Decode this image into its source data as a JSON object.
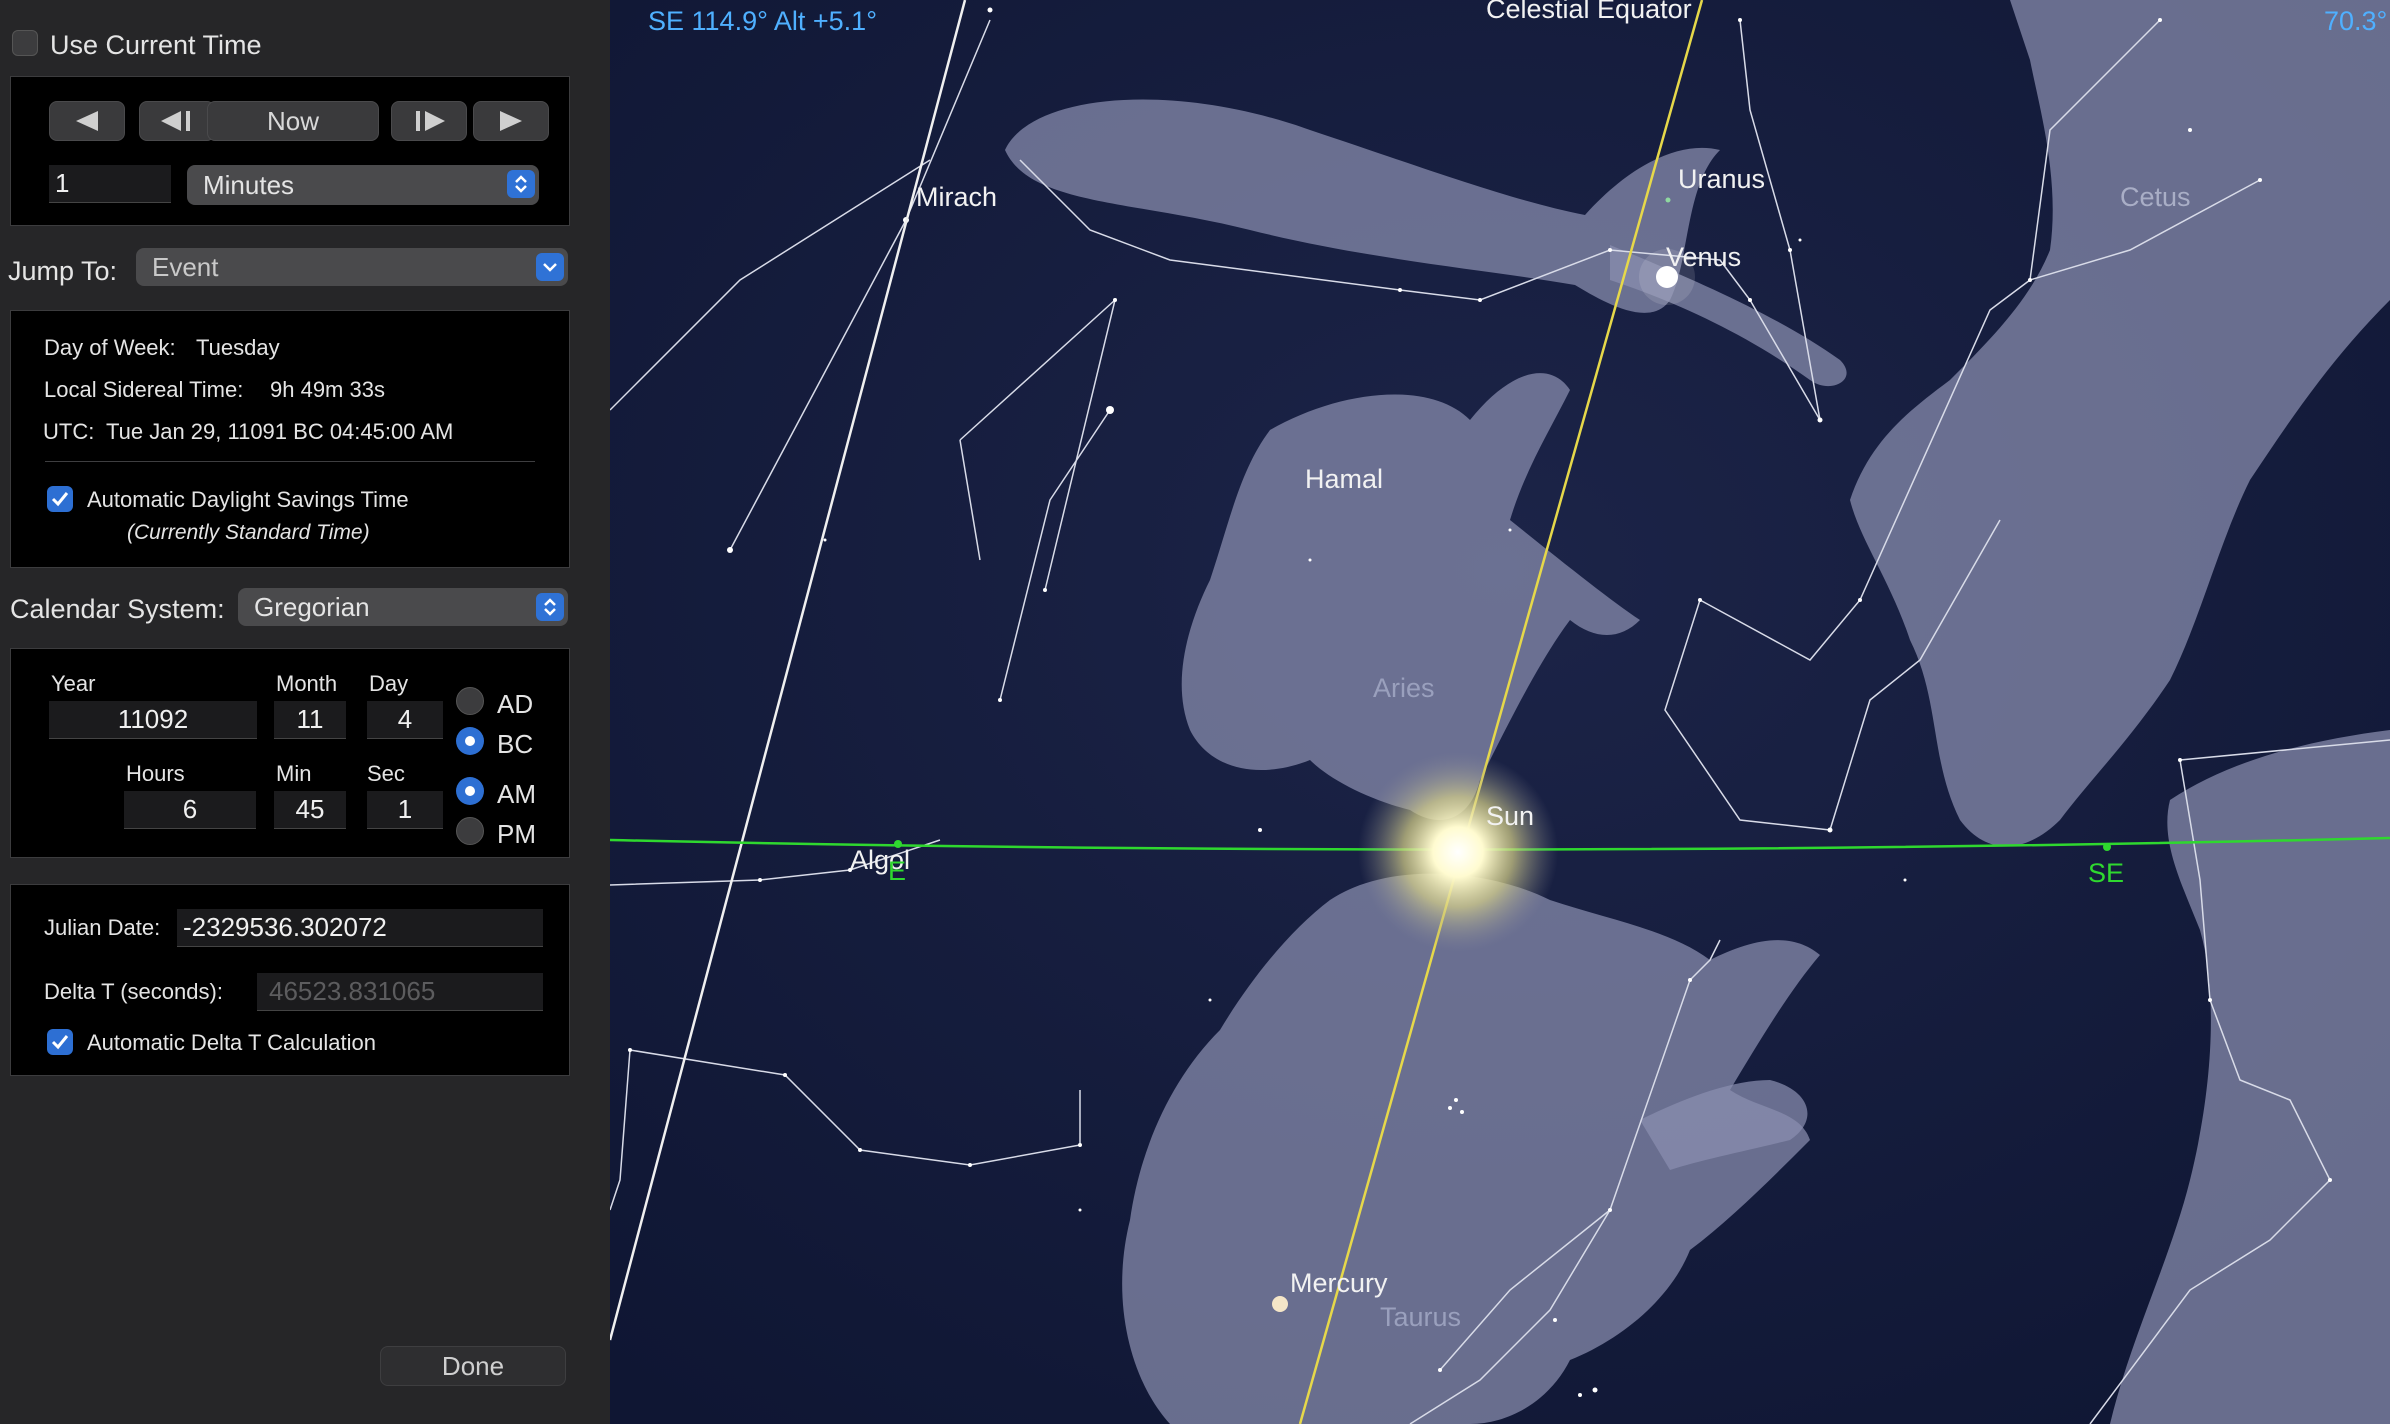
{
  "time_panel": {
    "use_current_time_label": "Use Current Time",
    "now_label": "Now",
    "step_value": "1",
    "step_unit": "Minutes",
    "jump_to_label": "Jump To:",
    "jump_to_value": "Event"
  },
  "info": {
    "day_of_week_label": "Day of Week:",
    "day_of_week_value": "Tuesday",
    "lst_label": "Local Sidereal Time:",
    "lst_value": "9h 49m 33s",
    "utc_label": "UTC:",
    "utc_value": "Tue Jan 29, 11091 BC 04:45:00 AM",
    "dst_label": "Automatic Daylight Savings Time",
    "dst_note": "(Currently Standard Time)"
  },
  "calendar": {
    "label": "Calendar System:",
    "value": "Gregorian"
  },
  "date_fields": {
    "year_label": "Year",
    "year": "11092",
    "month_label": "Month",
    "month": "11",
    "day_label": "Day",
    "day": "4",
    "hours_label": "Hours",
    "hours": "6",
    "min_label": "Min",
    "min": "45",
    "sec_label": "Sec",
    "sec": "1",
    "ad_label": "AD",
    "bc_label": "BC",
    "am_label": "AM",
    "pm_label": "PM"
  },
  "julian": {
    "julian_label": "Julian Date:",
    "julian_value": "-2329536.302072",
    "delta_t_label": "Delta T (seconds):",
    "delta_t_value": "46523.831065",
    "auto_delta_label": "Automatic Delta T Calculation"
  },
  "done_label": "Done",
  "sky": {
    "readout": "SE 114.9° Alt +5.1°",
    "readout_right": "70.3°",
    "celestial_equator": "Celestial Equator",
    "labels": {
      "mirach": "Mirach",
      "uranus": "Uranus",
      "venus": "Venus",
      "hamal": "Hamal",
      "aries": "Aries",
      "sun": "Sun",
      "algol": "Algol",
      "e": "E",
      "se": "SE",
      "mercury": "Mercury",
      "taurus": "Taurus",
      "cetus": "Cetus"
    }
  },
  "colors": {
    "accent": "#2d6fd3",
    "horizon": "#2fd82f",
    "ecliptic": "#e6d84a",
    "readout": "#4fb0ff"
  }
}
